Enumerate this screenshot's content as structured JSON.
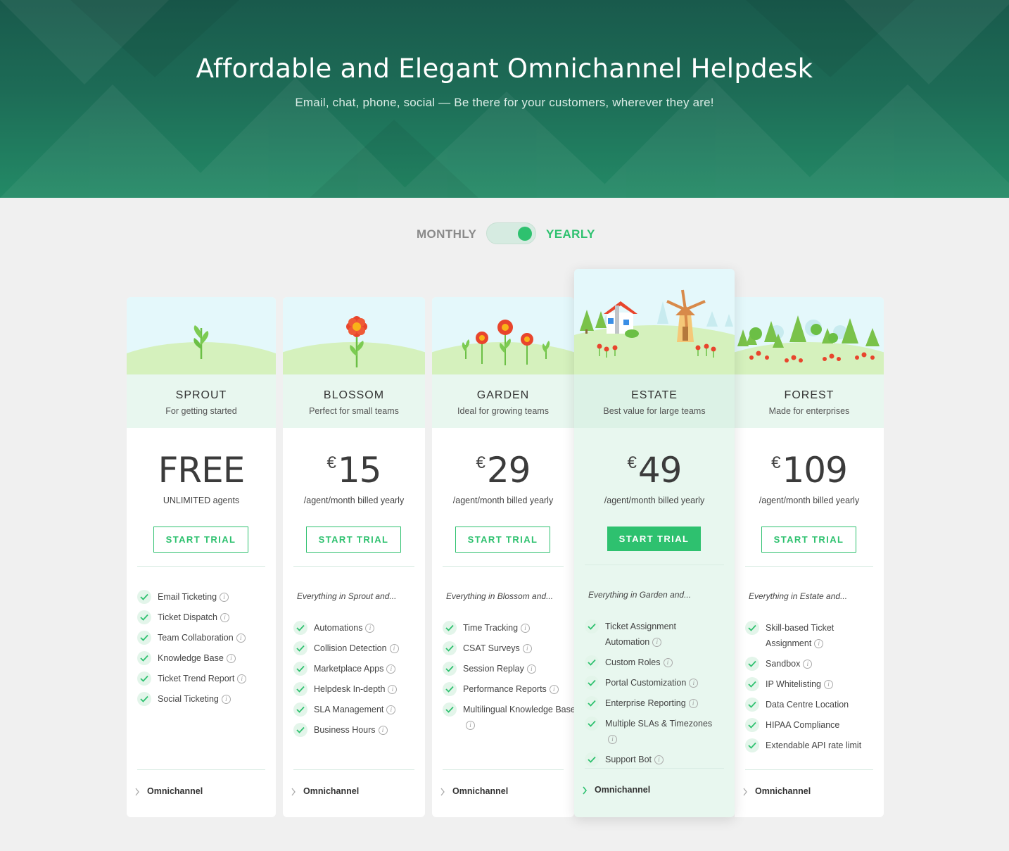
{
  "hero": {
    "title": "Affordable and Elegant Omnichannel Helpdesk",
    "subtitle": "Email, chat, phone, social — Be there for your customers, wherever they are!"
  },
  "billing": {
    "monthly_label": "MONTHLY",
    "yearly_label": "YEARLY",
    "selected": "yearly"
  },
  "colors": {
    "accent": "#2ec16f",
    "hero_dark": "#195a4c",
    "hero_light": "#238a66",
    "card_tint": "#e8f7ef"
  },
  "plans": [
    {
      "name": "SPROUT",
      "tagline": "For getting started",
      "currency": "",
      "price": "FREE",
      "unit": "UNLIMITED agents",
      "cta": "START TRIAL",
      "intro": "",
      "features": [
        "Email Ticketing",
        "Ticket Dispatch",
        "Team Collaboration",
        "Knowledge Base",
        "Ticket Trend Report",
        "Social Ticketing"
      ],
      "footer": "Omnichannel"
    },
    {
      "name": "BLOSSOM",
      "tagline": "Perfect for small teams",
      "currency": "€",
      "price": "15",
      "unit": "/agent/month billed yearly",
      "cta": "START TRIAL",
      "intro": "Everything in Sprout and...",
      "features": [
        "Automations",
        "Collision Detection",
        "Marketplace Apps",
        "Helpdesk In-depth",
        "SLA Management",
        "Business Hours"
      ],
      "footer": "Omnichannel"
    },
    {
      "name": "GARDEN",
      "tagline": "Ideal for growing teams",
      "currency": "€",
      "price": "29",
      "unit": "/agent/month billed yearly",
      "cta": "START TRIAL",
      "intro": "Everything in Blossom and...",
      "features": [
        "Time Tracking",
        "CSAT Surveys",
        "Session Replay",
        "Performance Reports",
        "Multilingual Knowledge Base"
      ],
      "footer": "Omnichannel"
    },
    {
      "name": "ESTATE",
      "tagline": "Best value for large teams",
      "currency": "€",
      "price": "49",
      "unit": "/agent/month billed yearly",
      "cta": "START TRIAL",
      "intro": "Everything in Garden and...",
      "features": [
        "Ticket Assignment Automation",
        "Custom Roles",
        "Portal Customization",
        "Enterprise Reporting",
        "Multiple SLAs & Timezones",
        "Support Bot"
      ],
      "footer": "Omnichannel"
    },
    {
      "name": "FOREST",
      "tagline": "Made for enterprises",
      "currency": "€",
      "price": "109",
      "unit": "/agent/month billed yearly",
      "cta": "START TRIAL",
      "intro": "Everything in Estate and...",
      "features": [
        "Skill-based Ticket Assignment",
        "Sandbox",
        "IP Whitelisting",
        "Data Centre Location",
        "HIPAA Compliance",
        "Extendable API rate limit"
      ],
      "footer": "Omnichannel"
    }
  ]
}
